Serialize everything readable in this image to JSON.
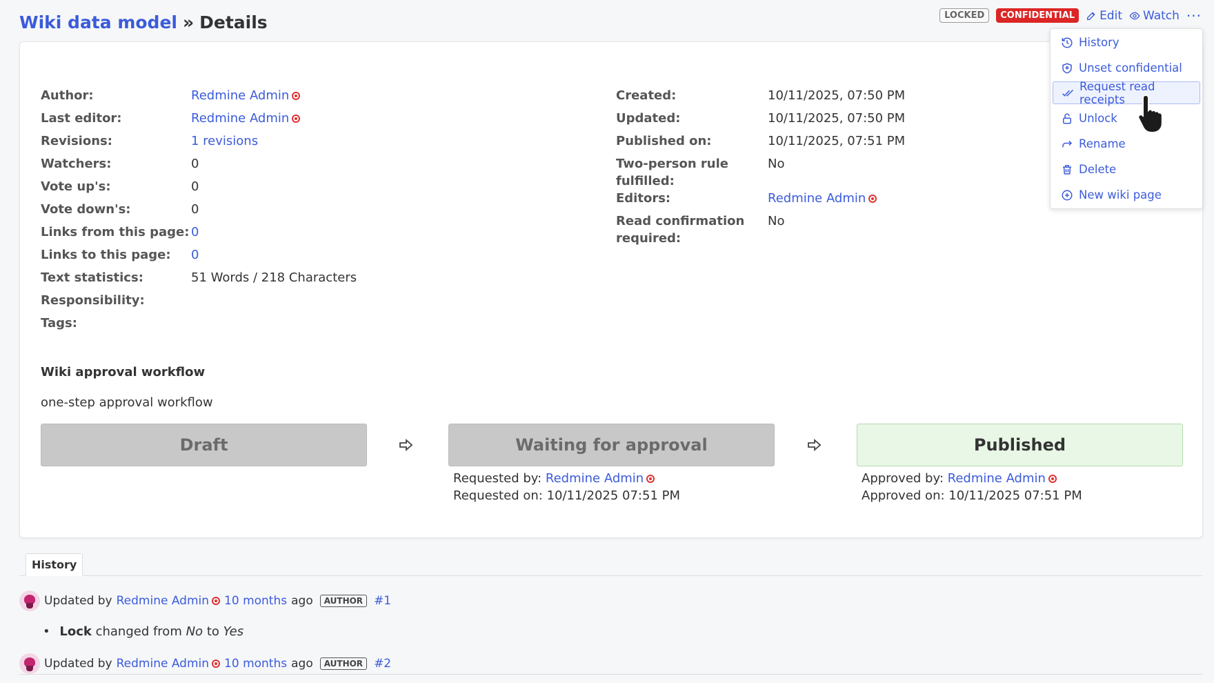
{
  "header": {
    "breadcrumb_link": "Wiki data model",
    "separator": "»",
    "page_title": "Details",
    "badge_locked": "LOCKED",
    "badge_confidential": "CONFIDENTIAL",
    "edit_label": "Edit",
    "watch_label": "Watch",
    "more_label": "···"
  },
  "left_fields": [
    {
      "label": "Author:",
      "value": "Redmine Admin",
      "kind": "user"
    },
    {
      "label": "Last editor:",
      "value": "Redmine Admin",
      "kind": "user"
    },
    {
      "label": "Revisions:",
      "value": "1 revisions",
      "kind": "link"
    },
    {
      "label": "Watchers:",
      "value": "0",
      "kind": "text"
    },
    {
      "label": "Vote up's:",
      "value": "0",
      "kind": "text"
    },
    {
      "label": "Vote down's:",
      "value": "0",
      "kind": "text"
    },
    {
      "label": "Links from this page:",
      "value": "0",
      "kind": "link"
    },
    {
      "label": "Links to this page:",
      "value": "0",
      "kind": "link"
    },
    {
      "label": "Text statistics:",
      "value": "51 Words / 218 Characters",
      "kind": "text"
    },
    {
      "label": "Responsibility:",
      "value": "",
      "kind": "text"
    },
    {
      "label": "Tags:",
      "value": "",
      "kind": "text"
    }
  ],
  "right_fields": [
    {
      "label": "Created:",
      "value": "10/11/2025, 07:50 PM",
      "kind": "text"
    },
    {
      "label": "Updated:",
      "value": "10/11/2025, 07:50 PM",
      "kind": "text"
    },
    {
      "label": "Published on:",
      "value": "10/11/2025, 07:51 PM",
      "kind": "text"
    },
    {
      "label": "Two-person rule",
      "label2": "fulfilled:",
      "value": "No",
      "kind": "text"
    },
    {
      "label": "Editors:",
      "value": "Redmine Admin",
      "kind": "user"
    },
    {
      "label": "Read confirmation",
      "label2": "required:",
      "value": "No",
      "kind": "text"
    }
  ],
  "workflow": {
    "title": "Wiki approval workflow",
    "name": "one-step approval workflow",
    "steps": [
      "Draft",
      "Waiting for approval",
      "Published"
    ],
    "requested_by_label": "Requested by:",
    "requested_by": "Redmine Admin",
    "requested_on_label": "Requested on:",
    "requested_on": "10/11/2025 07:51 PM",
    "approved_by_label": "Approved by:",
    "approved_by": "Redmine Admin",
    "approved_on_label": "Approved on:",
    "approved_on": "10/11/2025 07:51 PM"
  },
  "menu": {
    "items": [
      {
        "label": "History",
        "icon": "history-icon"
      },
      {
        "label": "Unset confidential",
        "icon": "shield-icon"
      },
      {
        "label": "Request read receipts",
        "icon": "double-check-icon"
      },
      {
        "label": "Unlock",
        "icon": "lock-icon"
      },
      {
        "label": "Rename",
        "icon": "rename-arrow-icon"
      },
      {
        "label": "Delete",
        "icon": "trash-icon"
      },
      {
        "label": "New wiki page",
        "icon": "plus-circle-icon"
      }
    ],
    "active_index": 2
  },
  "history": {
    "tab_label": "History",
    "entries": [
      {
        "prefix": "Updated by",
        "user": "Redmine Admin",
        "time": "10 months",
        "suffix": "ago",
        "role": "AUTHOR",
        "number": "#1"
      },
      {
        "prefix": "Updated by",
        "user": "Redmine Admin",
        "time": "10 months",
        "suffix": "ago",
        "role": "AUTHOR",
        "number": "#2"
      }
    ],
    "change": {
      "field": "Lock",
      "text1": "changed from",
      "from": "No",
      "text2": "to",
      "to": "Yes"
    }
  },
  "colors": {
    "accent": "#3b5bdb",
    "confidential": "#dc2626",
    "published_bg": "#e9f7e6"
  }
}
